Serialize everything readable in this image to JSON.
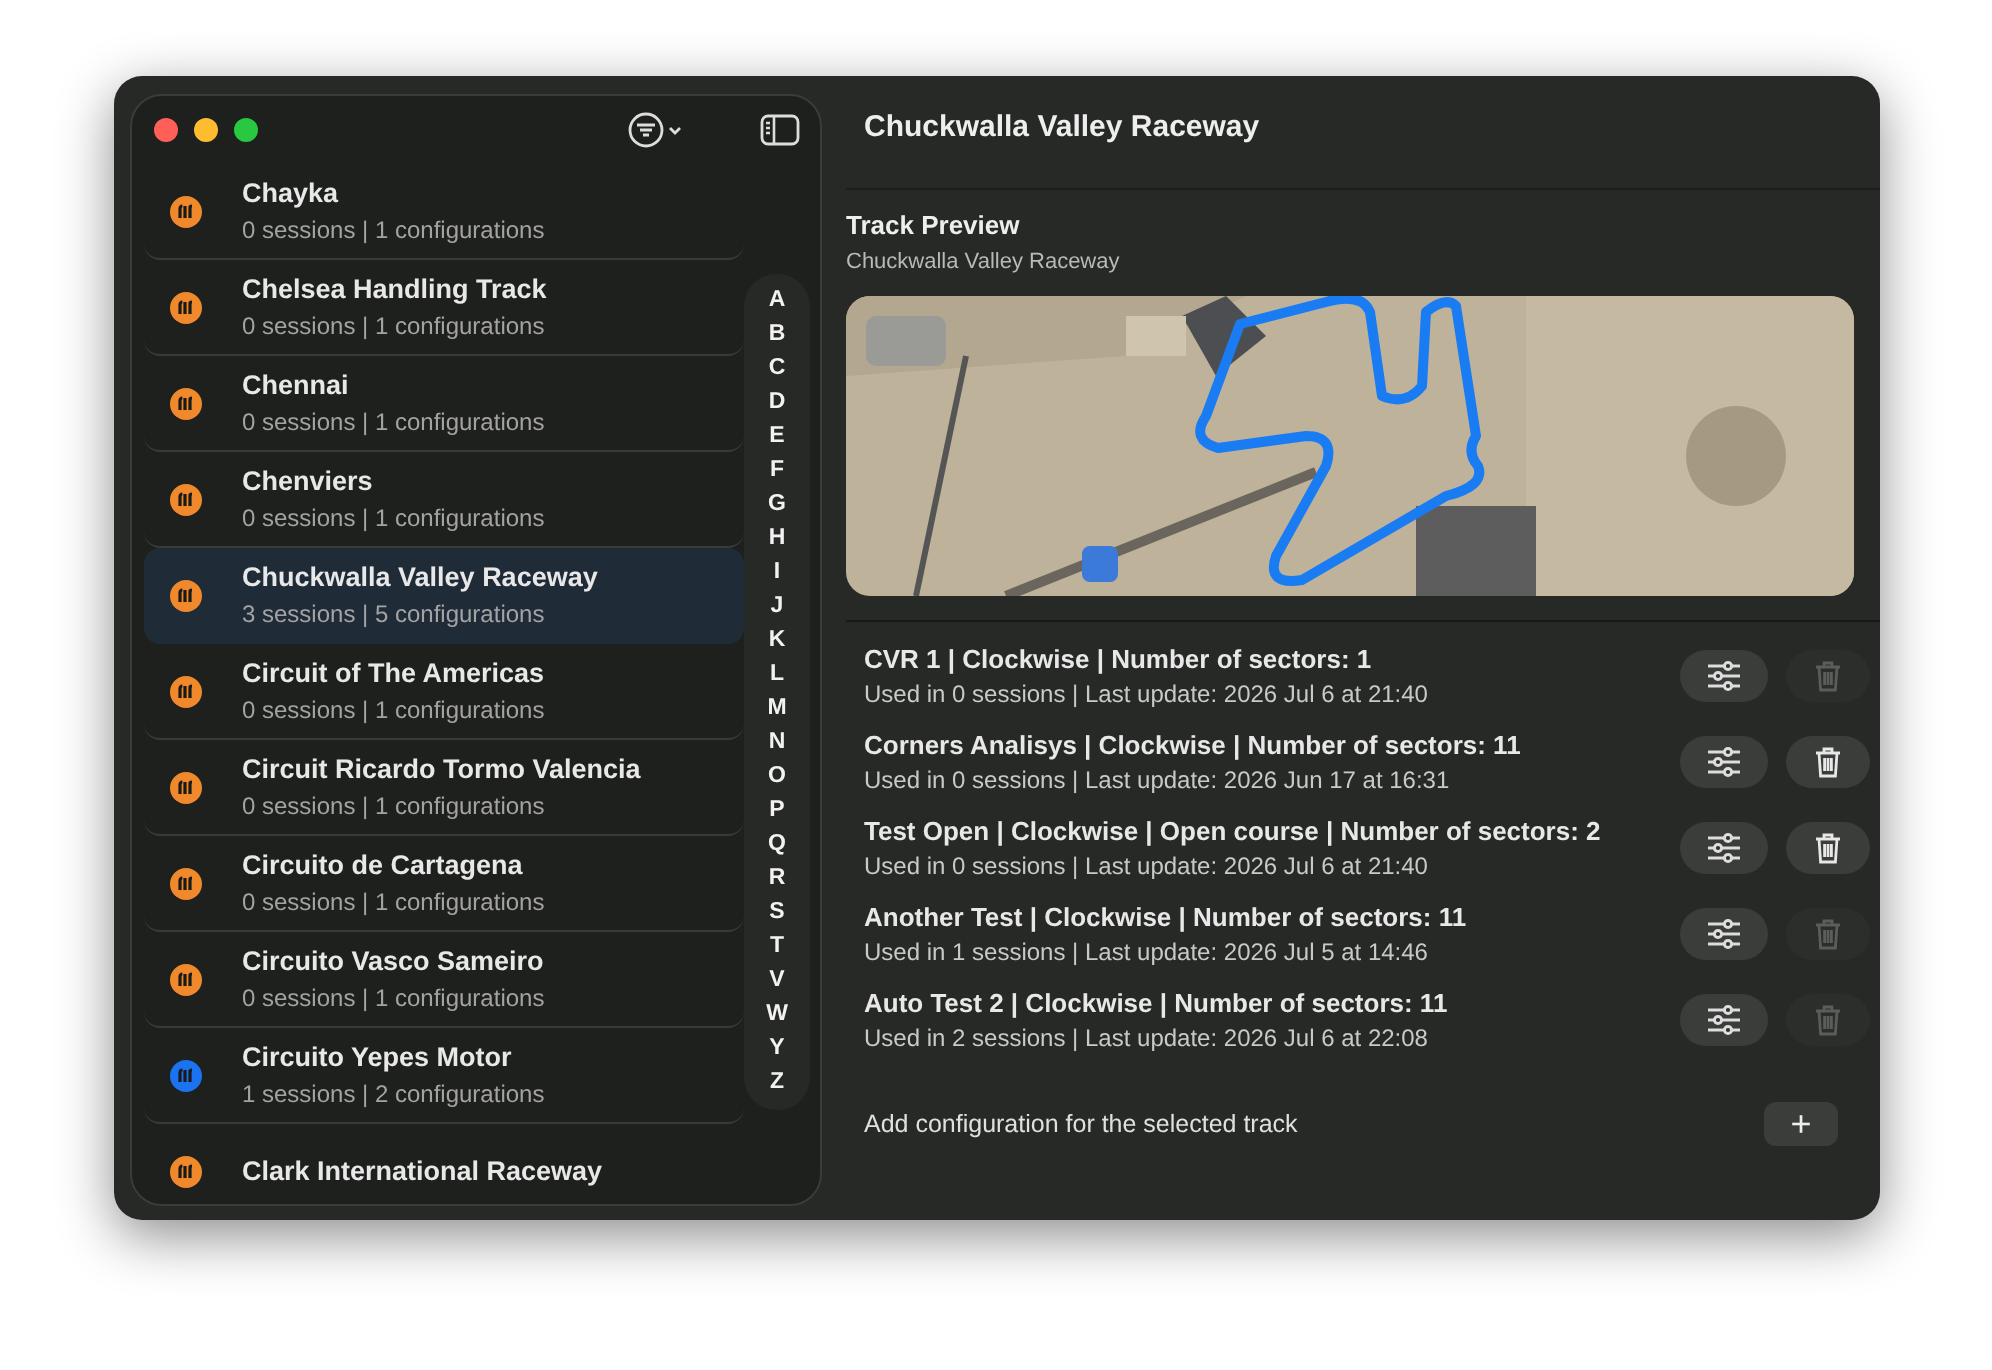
{
  "window": {
    "title": "Chuckwalla Valley Raceway"
  },
  "sidebar": {
    "tracks": [
      {
        "name": "Chayka",
        "details": "0 sessions | 1 configurations",
        "color": "#f0892c",
        "selected": false
      },
      {
        "name": "Chelsea Handling Track",
        "details": "0 sessions | 1 configurations",
        "color": "#f0892c",
        "selected": false
      },
      {
        "name": "Chennai",
        "details": "0 sessions | 1 configurations",
        "color": "#f0892c",
        "selected": false
      },
      {
        "name": "Chenviers",
        "details": "0 sessions | 1 configurations",
        "color": "#f0892c",
        "selected": false
      },
      {
        "name": "Chuckwalla Valley Raceway",
        "details": "3 sessions | 5 configurations",
        "color": "#f0892c",
        "selected": true
      },
      {
        "name": "Circuit of The Americas",
        "details": "0 sessions | 1 configurations",
        "color": "#f0892c",
        "selected": false
      },
      {
        "name": "Circuit Ricardo Tormo Valencia",
        "details": "0 sessions | 1 configurations",
        "color": "#f0892c",
        "selected": false
      },
      {
        "name": "Circuito de Cartagena",
        "details": "0 sessions | 1 configurations",
        "color": "#f0892c",
        "selected": false
      },
      {
        "name": "Circuito Vasco Sameiro",
        "details": "0 sessions | 1 configurations",
        "color": "#f0892c",
        "selected": false
      },
      {
        "name": "Circuito Yepes Motor",
        "details": "1 sessions | 2 configurations",
        "color": "#1a73f0",
        "selected": false
      },
      {
        "name": "Clark International Raceway",
        "color": "#f0892c",
        "selected": false
      }
    ],
    "index": [
      "A",
      "B",
      "C",
      "D",
      "E",
      "F",
      "G",
      "H",
      "I",
      "J",
      "K",
      "L",
      "M",
      "N",
      "O",
      "P",
      "Q",
      "R",
      "S",
      "T",
      "V",
      "W",
      "Y",
      "Z"
    ]
  },
  "preview": {
    "title": "Track Preview",
    "subtitle": "Chuckwalla Valley Raceway"
  },
  "configurations": [
    {
      "title": "CVR 1 | Clockwise | Number of sectors: 1",
      "details": "Used in 0 sessions | Last update: 2026 Jul 6 at 21:40",
      "delete_disabled": true
    },
    {
      "title": "Corners Analisys | Clockwise | Number of sectors: 11",
      "details": "Used in 0 sessions | Last update: 2026 Jun 17 at 16:31",
      "delete_disabled": false
    },
    {
      "title": "Test Open | Clockwise | Open course | Number of sectors: 2",
      "details": "Used in 0 sessions | Last update: 2026 Jul 6 at 21:40",
      "delete_disabled": false
    },
    {
      "title": "Another Test | Clockwise | Number of sectors: 11",
      "details": "Used in 1 sessions | Last update: 2026 Jul 5 at 14:46",
      "delete_disabled": true
    },
    {
      "title": "Auto Test 2 | Clockwise | Number of sectors: 11",
      "details": "Used in 2 sessions | Last update: 2026 Jul 6 at 22:08",
      "delete_disabled": true
    }
  ],
  "add_configuration": {
    "label": "Add configuration for the selected track",
    "button": "+"
  }
}
